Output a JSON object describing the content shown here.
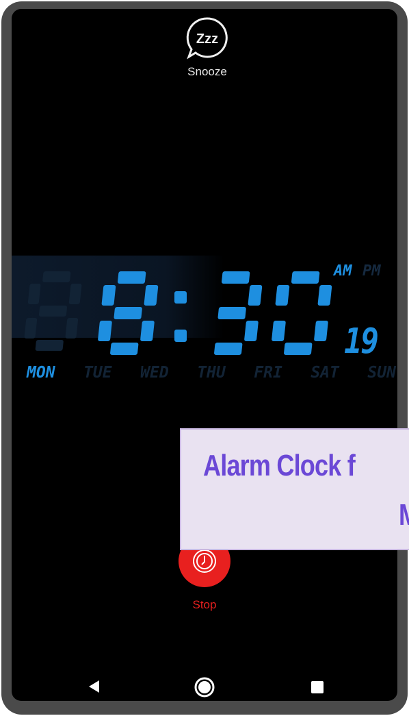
{
  "snooze": {
    "label": "Snooze",
    "icon_text": "Zzz",
    "icon": "snooze-bubble-icon"
  },
  "clock": {
    "time": "8:30",
    "hour": "8",
    "minutes": "30",
    "seconds": "19",
    "am_label": "AM",
    "pm_label": "PM",
    "active_period": "AM",
    "digit_color": "#1e8fe0",
    "inactive_color": "#122335"
  },
  "days": [
    {
      "label": "MON",
      "active": true
    },
    {
      "label": "TUE",
      "active": false
    },
    {
      "label": "WED",
      "active": false
    },
    {
      "label": "THU",
      "active": false
    },
    {
      "label": "FRI",
      "active": false
    },
    {
      "label": "SAT",
      "active": false
    },
    {
      "label": "SUN",
      "active": false
    }
  ],
  "stop": {
    "label": "Stop",
    "icon": "alarm-stop-icon",
    "color": "#e8201f"
  },
  "navbar": {
    "back_icon": "back-triangle-icon",
    "home_icon": "home-circle-icon",
    "recent_icon": "recents-square-icon"
  },
  "banner": {
    "line1": "Alarm Clock f",
    "line2": "M",
    "text_color": "#6b48d6",
    "background": "#e9e2f1"
  }
}
